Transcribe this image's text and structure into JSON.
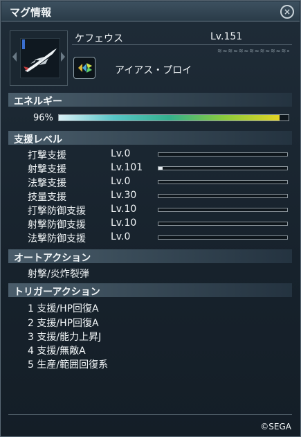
{
  "window": {
    "title": "マグ情報"
  },
  "mag": {
    "name": "ケフェウス",
    "level": "Lv.151",
    "photon_blast": "アイアス・プロイ"
  },
  "energy": {
    "heading": "エネルギー",
    "percent_label": "96%",
    "fraction": 0.96
  },
  "support": {
    "heading": "支援レベル",
    "rows": [
      {
        "label": "打撃支援",
        "level": "Lv.0",
        "fraction": 0.0
      },
      {
        "label": "射撃支援",
        "level": "Lv.101",
        "fraction": 0.03
      },
      {
        "label": "法撃支援",
        "level": "Lv.0",
        "fraction": 0.0
      },
      {
        "label": "技量支援",
        "level": "Lv.30",
        "fraction": 0.0
      },
      {
        "label": "打撃防御支援",
        "level": "Lv.10",
        "fraction": 0.0
      },
      {
        "label": "射撃防御支援",
        "level": "Lv.10",
        "fraction": 0.0
      },
      {
        "label": "法撃防御支援",
        "level": "Lv.0",
        "fraction": 0.0
      }
    ]
  },
  "auto_action": {
    "heading": "オートアクション",
    "value": "射撃/炎炸裂弾"
  },
  "trigger_action": {
    "heading": "トリガーアクション",
    "items": [
      "1 支援/HP回復A",
      "2 支援/HP回復A",
      "3 支援/能力上昇J",
      "4 支援/無敵A",
      "5 生産/範囲回復系"
    ]
  },
  "footer": {
    "copyright": "©SEGA"
  }
}
